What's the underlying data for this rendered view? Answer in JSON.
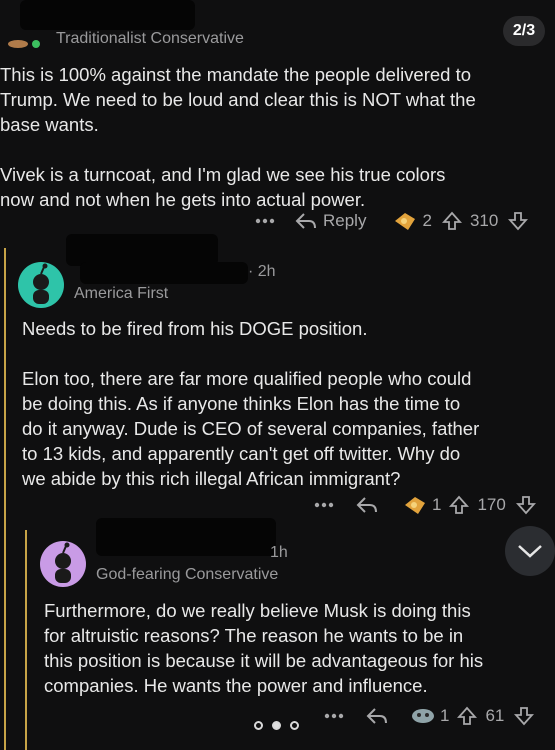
{
  "pager": "2/3",
  "comments": [
    {
      "author": "Traditionalist Conservative",
      "body": "This is 100% against the mandate the people delivered to\nTrump. We need to be loud and clear this is NOT what the\nbase wants.\n\nVivek is a turncoat, and I'm glad we see his true colors\nnow and not when he gets into actual power.",
      "reply_label": "Reply",
      "award_count": "2",
      "vote_count": "310"
    },
    {
      "author": "America First",
      "time": "· 2h",
      "body": "Needs to be fired from his DOGE position.\n\nElon too, there are far more qualified people who could\nbe doing this. As if anyone thinks Elon has the time to\ndo it anyway. Dude is CEO of several companies, father\nto 13 kids, and apparently can't get off twitter. Why do\nwe abide by this rich illegal African immigrant?",
      "award_count": "1",
      "vote_count": "170"
    },
    {
      "author": "God-fearing Conservative",
      "time": "1h",
      "body": "Furthermore, do we really believe Musk is doing this\nfor altruistic reasons? The reason he wants to be in\nthis position is because it will be advantageous for his\ncompanies. He wants the power and influence.",
      "award_count": "1",
      "vote_count": "61"
    }
  ],
  "icons": [
    "more-icon",
    "reply-icon",
    "award-icon",
    "upvote-icon",
    "downvote-icon",
    "chevron-down-icon",
    "avatar-icon"
  ],
  "colors": {
    "background": "#0f0f10",
    "thread_line": "#c6a347",
    "avatar_teal": "#2ec4a9",
    "avatar_purple": "#c99be6"
  },
  "carousel": {
    "pages": 3,
    "active": 2
  }
}
